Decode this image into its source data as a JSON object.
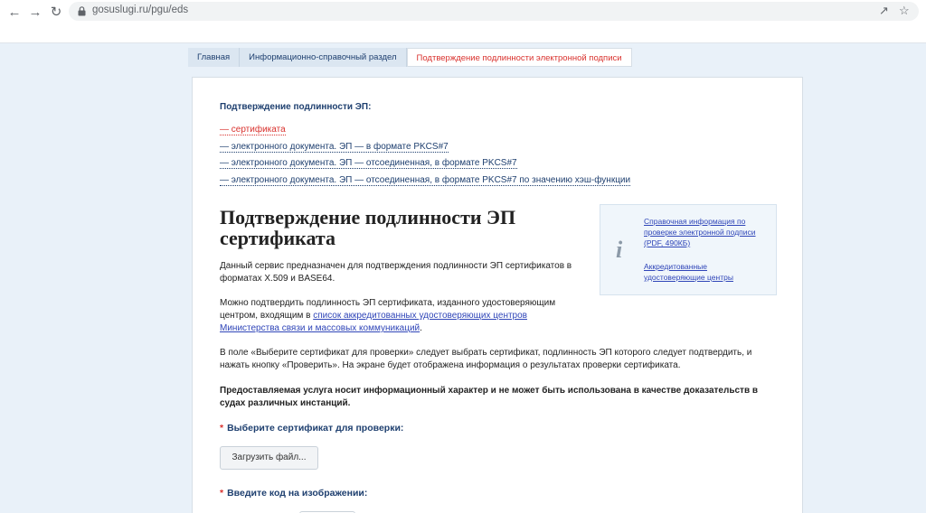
{
  "browser": {
    "url": "gosuslugi.ru/pgu/eds",
    "back_icon": "arrow-left-icon",
    "forward_icon": "arrow-right-icon",
    "reload_icon": "reload-icon"
  },
  "breadcrumb": {
    "items": [
      "Главная",
      "Информационно-справочный раздел",
      "Подтверждение подлинности электронной подписи"
    ]
  },
  "section": {
    "title": "Подтверждение подлинности ЭП:",
    "links": [
      "— сертификата",
      "— электронного документа. ЭП — в формате PKCS#7",
      "— электронного документа. ЭП — отсоединенная, в формате PKCS#7",
      "— электронного документа. ЭП — отсоединенная, в формате PKCS#7 по значению хэш-функции"
    ]
  },
  "main": {
    "title": "Подтверждение подлинности ЭП сертификата",
    "p1": "Данный сервис предназначен для подтверждения подлинности ЭП сертификатов в форматах X.509 и BASE64.",
    "p2_before": "Можно подтвердить подлинность ЭП сертификата, изданного удостоверяющим центром, входящим в ",
    "p2_link": "список аккредитованных удостоверяющих центров Министерства связи и массовых коммуникаций",
    "p2_after": ".",
    "p3": "В поле «Выберите сертификат для проверки» следует выбрать сертификат, подлинность ЭП которого следует подтвердить, и нажать кнопку «Проверить». На экране будет отображена информация о результатах проверки сертификата.",
    "p4": "Предоставляемая услуга носит информационный характер и не может быть использована в качестве доказательств в судах различных инстанций."
  },
  "form": {
    "required_mark": "*",
    "select_label": "Выберите сертификат для проверки:",
    "upload_button": "Загрузить файл...",
    "captcha_label": "Введите код на изображении:"
  },
  "info": {
    "icon": "info-icon",
    "link1": "Справочная информация по проверке электронной подписи (PDF, 490КБ)",
    "link2": "Аккредитованные удостоверяющие центры"
  },
  "colors": {
    "accent_blue": "#1e3f6f",
    "link_blue": "#2f45b8",
    "active_red": "#d9322e",
    "page_bg": "#e9f1f9"
  }
}
